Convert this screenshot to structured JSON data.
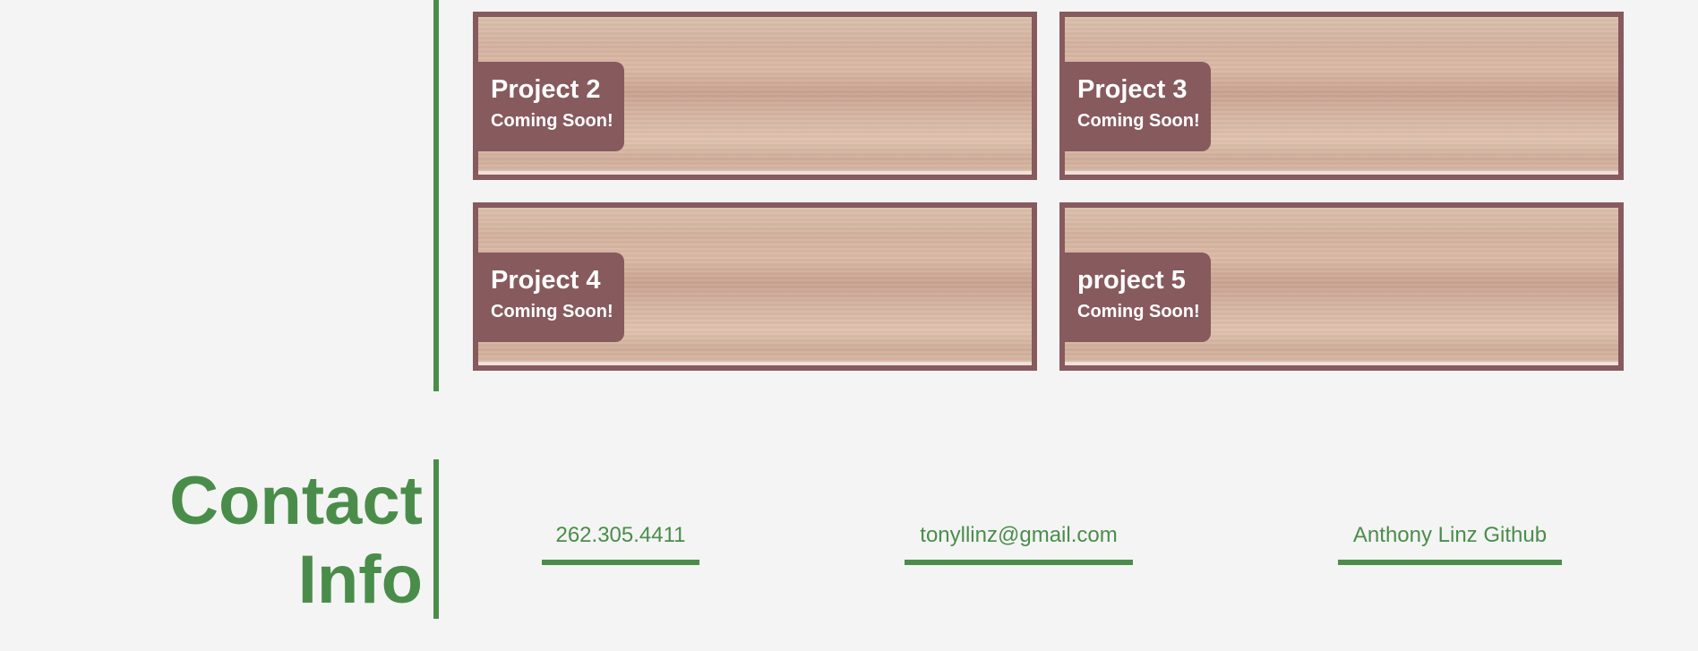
{
  "projects": [
    {
      "title": "Project 2",
      "status": "Coming Soon!"
    },
    {
      "title": "Project 3",
      "status": "Coming Soon!"
    },
    {
      "title": "Project 4",
      "status": "Coming Soon!"
    },
    {
      "title": "project 5",
      "status": "Coming Soon!"
    }
  ],
  "contact": {
    "title_line1": "Contact",
    "title_line2": "Info",
    "phone": "262.305.4411",
    "email": "tonyllinz@gmail.com",
    "github": "Anthony Linz Github"
  },
  "colors": {
    "accent_green": "#4a8d4a",
    "card_border": "#875a5e",
    "background": "#f4f4f4"
  }
}
